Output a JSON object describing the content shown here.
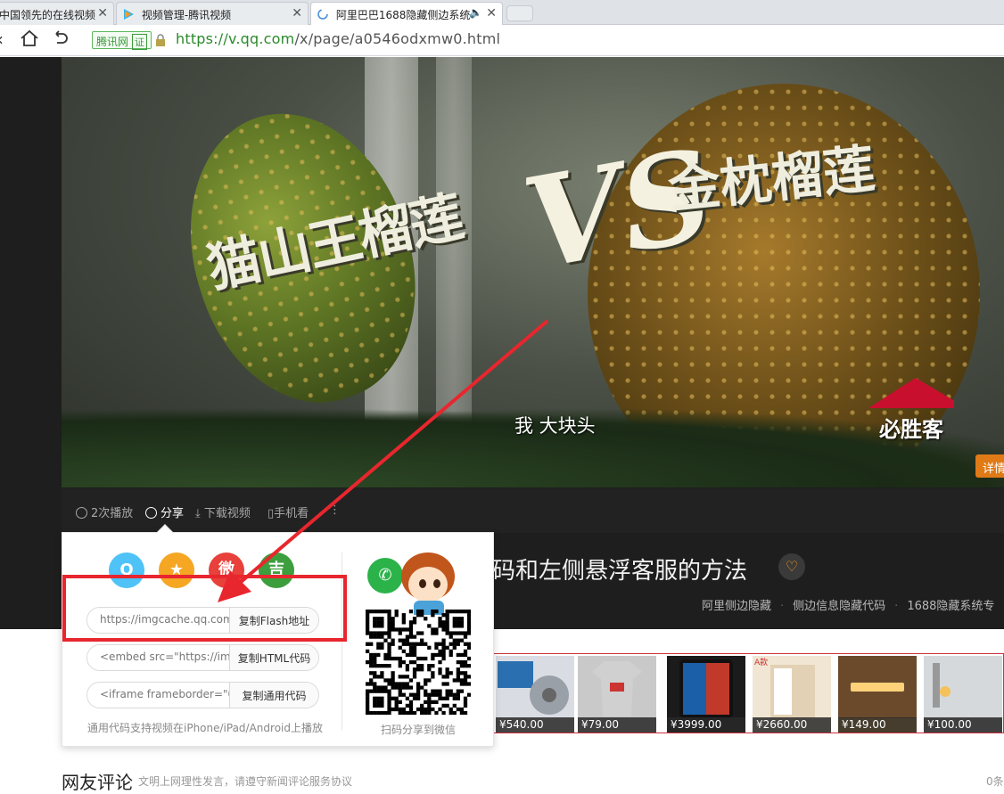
{
  "browser": {
    "tabs": [
      {
        "label": "中国领先的在线视频",
        "active": false
      },
      {
        "label": "视频管理-腾讯视频",
        "active": false
      },
      {
        "label": "阿里巴巴1688隐藏侧边系统",
        "active": true
      }
    ],
    "cert_label": "腾讯网",
    "cert_badge": "证",
    "url_scheme_host": "https://v.qq.com",
    "url_path": "/x/page/a0546odxmw0.html"
  },
  "video": {
    "title_left": "猫山王榴莲",
    "title_vs": "VS",
    "title_right": "金枕榴莲",
    "subtitle": "我 大块头",
    "brand": "必胜客",
    "detail_button": "详情"
  },
  "toolbar": {
    "plays": "2次播放",
    "share": "分享",
    "download": "下载视频",
    "mobile": "手机看",
    "more": "⋮"
  },
  "page_title": "码和左侧悬浮客服的方法",
  "tags": [
    "阿里侧边隐藏",
    "侧边信息隐藏代码",
    "1688隐藏系统专"
  ],
  "share_popup": {
    "qq_icon": "Q",
    "qzone_icon": "★",
    "weibo_icon": "微",
    "tencent_icon": "吉",
    "rows": [
      {
        "value": "https://imgcache.qq.com",
        "copy": "复制Flash地址"
      },
      {
        "value": "<embed src=\"https://im",
        "copy": "复制HTML代码"
      },
      {
        "value": "<iframe frameborder=\"0\"",
        "copy": "复制通用代码"
      }
    ],
    "note": "通用代码支持视频在iPhone/iPad/Android上播放",
    "scan_label": "扫码分享到微信"
  },
  "ads": [
    {
      "price": "¥540.00",
      "color": "#d9dde3"
    },
    {
      "price": "¥79.00",
      "color": "#c9c9c9"
    },
    {
      "price": "¥3999.00",
      "color": "#1b1b1b"
    },
    {
      "price": "¥2660.00",
      "color": "#f1e6d4"
    },
    {
      "price": "¥149.00",
      "color": "#f2b35a"
    },
    {
      "price": "¥100.00",
      "color": "#bfc4ca"
    }
  ],
  "comments": {
    "heading": "网友评论",
    "note": "文明上网理性发言，请遵守新闻评论服务协议",
    "count": "0条"
  },
  "colors": {
    "accent_orange": "#e07a16",
    "annotation_red": "#e8262e",
    "url_green": "#2a8a2a"
  }
}
